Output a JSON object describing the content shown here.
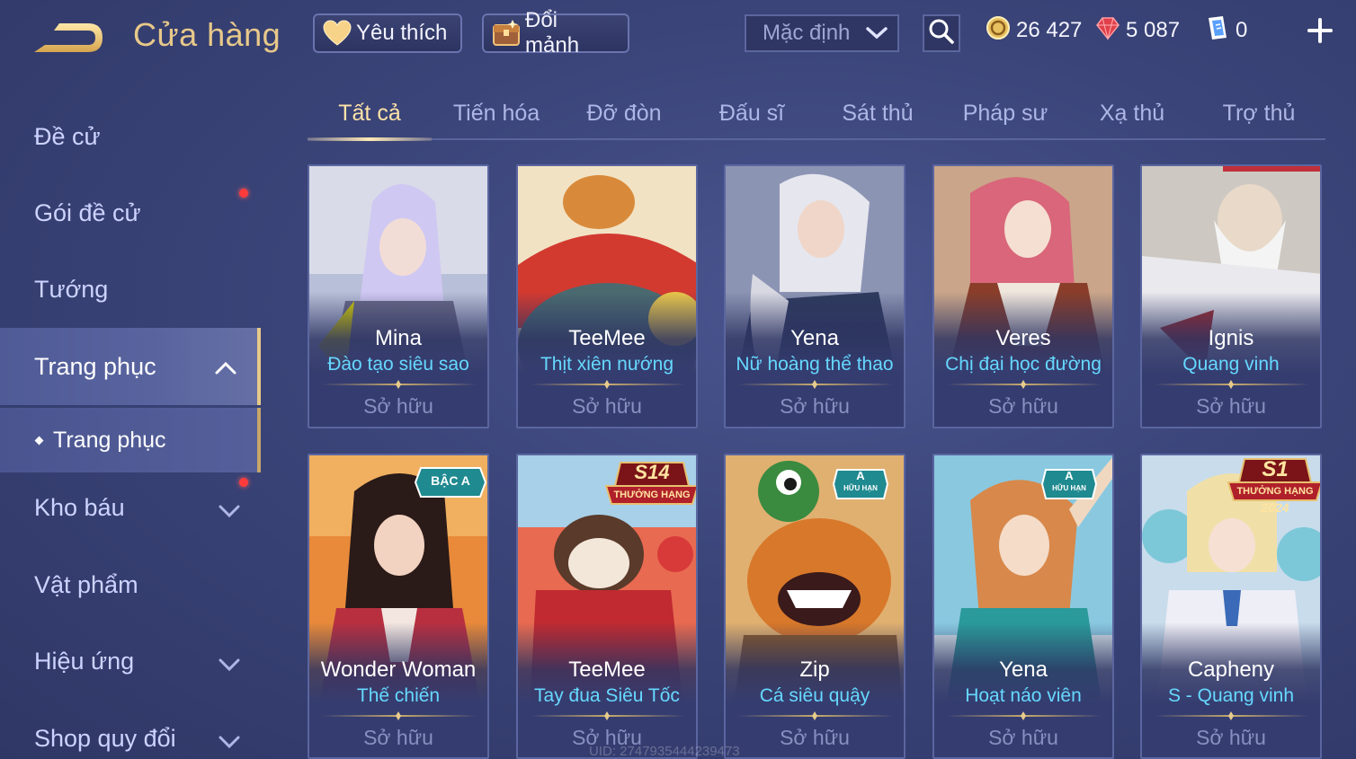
{
  "header": {
    "title": "Cửa hàng",
    "favorites_label": "Yêu thích",
    "shard_exchange_label": "Đổi mảnh",
    "sort": {
      "selected": "Mặc định"
    },
    "currencies": [
      {
        "name": "gold-coin",
        "value": "26 427",
        "color": "#e8c060"
      },
      {
        "name": "ruby-gem",
        "value": "5 087",
        "color": "#e0404a"
      },
      {
        "name": "voucher",
        "value": "0",
        "color": "#78b8ff"
      }
    ]
  },
  "sidebar": {
    "items": [
      {
        "label": "Đề cử"
      },
      {
        "label": "Gói đề cử",
        "has_notification": true
      },
      {
        "label": "Tướng"
      },
      {
        "label": "Trang phục",
        "expanded": true
      },
      {
        "label": "Kho báu",
        "has_notification": true
      },
      {
        "label": "Vật phẩm"
      },
      {
        "label": "Hiệu ứng"
      },
      {
        "label": "Shop quy đổi"
      }
    ],
    "sub_item": {
      "label": "Trang phục"
    }
  },
  "tabs": [
    "Tất cả",
    "Tiến hóa",
    "Đỡ đòn",
    "Đấu sĩ",
    "Sát thủ",
    "Pháp sư",
    "Xạ thủ",
    "Trợ thủ"
  ],
  "active_tab": "Tất cả",
  "skins": [
    {
      "hero": "Mina",
      "skin": "Đào tạo siêu sao",
      "status": "Sở hữu",
      "badge": ""
    },
    {
      "hero": "TeeMee",
      "skin": "Thịt xiên nướng",
      "status": "Sở hữu",
      "badge": ""
    },
    {
      "hero": "Yena",
      "skin": "Nữ hoàng thể thao",
      "status": "Sở hữu",
      "badge": ""
    },
    {
      "hero": "Veres",
      "skin": "Chị đại học đường",
      "status": "Sở hữu",
      "badge": ""
    },
    {
      "hero": "Ignis",
      "skin": "Quang vinh",
      "status": "Sở hữu",
      "badge": ""
    },
    {
      "hero": "Wonder Woman",
      "skin": "Thế chiến",
      "status": "Sở hữu",
      "badge": "BẬC A"
    },
    {
      "hero": "TeeMee",
      "skin": "Tay đua Siêu Tốc",
      "status": "Sở hữu",
      "badge": "S14",
      "badge_sub": "THƯỞNG HẠNG"
    },
    {
      "hero": "Zip",
      "skin": "Cá siêu quậy",
      "status": "Sở hữu",
      "badge": "A",
      "badge_sub": "HỮU HẠN"
    },
    {
      "hero": "Yena",
      "skin": "Hoạt náo viên",
      "status": "Sở hữu",
      "badge": "A",
      "badge_sub": "HỮU HẠN"
    },
    {
      "hero": "Capheny",
      "skin": "S - Quang vinh",
      "status": "Sở hữu",
      "badge": "S1",
      "badge_sub": "THƯỞNG HẠNG",
      "badge_year": "2024"
    }
  ],
  "uid_text": "UID: 2747935444239473"
}
